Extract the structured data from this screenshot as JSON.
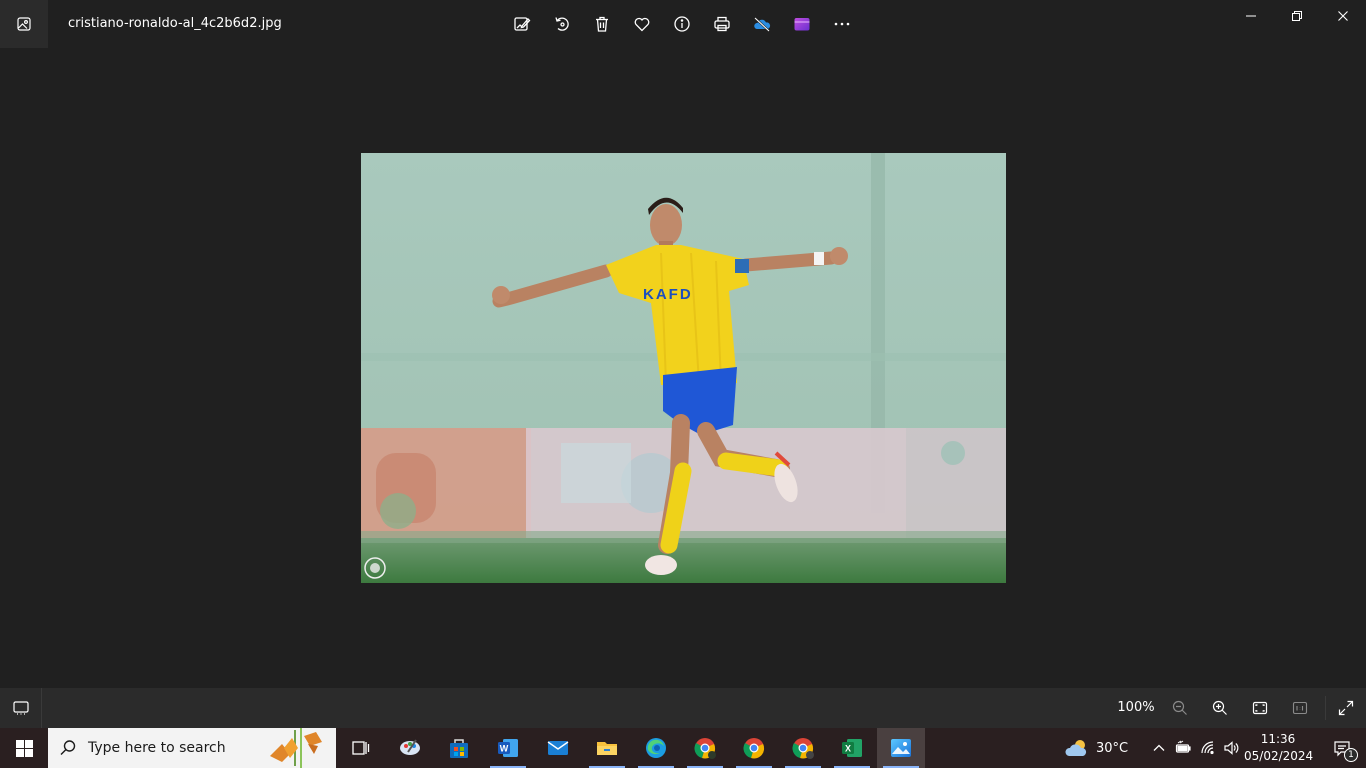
{
  "window": {
    "filename": "cristiano-ronaldo-al_4c2b6d2.jpg",
    "app_icon": "photos-app-icon",
    "controls": [
      "minimize-icon",
      "restore-icon",
      "close-icon"
    ]
  },
  "toolbar": {
    "buttons": [
      {
        "name": "edit-image-button",
        "icon": "edit-image-icon"
      },
      {
        "name": "rotate-button",
        "icon": "rotate-icon"
      },
      {
        "name": "delete-button",
        "icon": "trash-icon"
      },
      {
        "name": "favorite-button",
        "icon": "heart-icon"
      },
      {
        "name": "info-button",
        "icon": "info-icon"
      },
      {
        "name": "print-button",
        "icon": "printer-icon"
      },
      {
        "name": "onedrive-button",
        "icon": "onedrive-icon"
      },
      {
        "name": "video-editor-button",
        "icon": "clipchamp-icon"
      },
      {
        "name": "more-button",
        "icon": "ellipsis-icon"
      }
    ]
  },
  "bottombar": {
    "zoom_level": "100%",
    "icons": [
      "filmstrip-icon",
      "zoom-out-icon",
      "zoom-in-icon",
      "fit-window-icon",
      "actual-size-icon",
      "fullscreen-icon"
    ]
  },
  "taskbar": {
    "search_placeholder": "Type here to search",
    "apps": [
      {
        "name": "task-view",
        "icon": "task-view-icon"
      },
      {
        "name": "paint",
        "icon": "paint-icon"
      },
      {
        "name": "microsoft-store",
        "icon": "store-icon"
      },
      {
        "name": "word",
        "icon": "word-icon",
        "running": true
      },
      {
        "name": "mail",
        "icon": "mail-icon"
      },
      {
        "name": "file-explorer",
        "icon": "folder-icon",
        "running": true
      },
      {
        "name": "edge",
        "icon": "edge-icon",
        "running": true
      },
      {
        "name": "chrome-profile-1",
        "icon": "chrome-icon",
        "running": true
      },
      {
        "name": "chrome",
        "icon": "chrome-icon",
        "running": true
      },
      {
        "name": "chrome-profile-2",
        "icon": "chrome-icon",
        "running": true
      },
      {
        "name": "excel",
        "icon": "excel-icon",
        "running": true
      },
      {
        "name": "photos",
        "icon": "photos-icon",
        "running": true,
        "active": true
      }
    ],
    "weather": {
      "temp": "30°C",
      "icon": "partly-cloudy-icon"
    },
    "tray_icons": [
      "chevron-up-icon",
      "battery-icon",
      "wifi-icon",
      "volume-icon"
    ],
    "clock": {
      "time": "11:36",
      "date": "05/02/2024"
    },
    "notification_count": "1"
  },
  "colors": {
    "background": "#202020",
    "bottombar": "#2b2b2b",
    "taskbar": "#2a1f20",
    "accent": "#8ab4f8"
  }
}
